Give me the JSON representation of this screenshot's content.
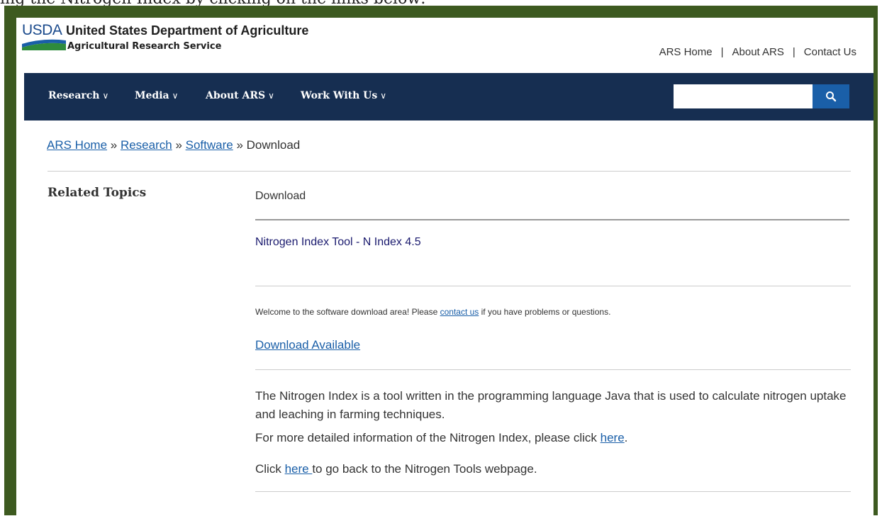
{
  "caption": "ing the Nitrogen Index by clicking on the links below:",
  "header": {
    "logo_text": "USDA",
    "department": "United States Department of Agriculture",
    "agency": "Agricultural Research Service",
    "util_links": [
      "ARS Home",
      "About ARS",
      "Contact Us"
    ],
    "separator": "|"
  },
  "nav": {
    "items": [
      "Research",
      "Media",
      "About ARS",
      "Work With Us"
    ],
    "chevron": "∨",
    "search_placeholder": "",
    "search_icon": "search-icon"
  },
  "breadcrumb": {
    "items": [
      "ARS Home",
      "Research",
      "Software"
    ],
    "current": "Download",
    "separator": "»"
  },
  "sidebar": {
    "heading": "Related Topics"
  },
  "main": {
    "title": "Download",
    "tool_name": "Nitrogen Index Tool - N Index 4.5",
    "welcome_prefix": "Welcome to the software download area! Please ",
    "welcome_link": "contact us",
    "welcome_suffix": " if you have problems or questions.",
    "download_link": "Download Available",
    "description": "The Nitrogen Index is a tool written in the programming language Java that is used to calculate nitrogen uptake and leaching in farming techniques.",
    "more_info_prefix": "For more detailed information of the Nitrogen Index, please click ",
    "more_info_link": "here",
    "more_info_suffix": ".",
    "back_prefix": "Click ",
    "back_link": "here ",
    "back_suffix": "to go back to the Nitrogen Tools webpage."
  },
  "colors": {
    "frame": "#3d5a20",
    "navbar": "#162e51",
    "link": "#1a5fa8",
    "search_button": "#1a5fa8"
  }
}
